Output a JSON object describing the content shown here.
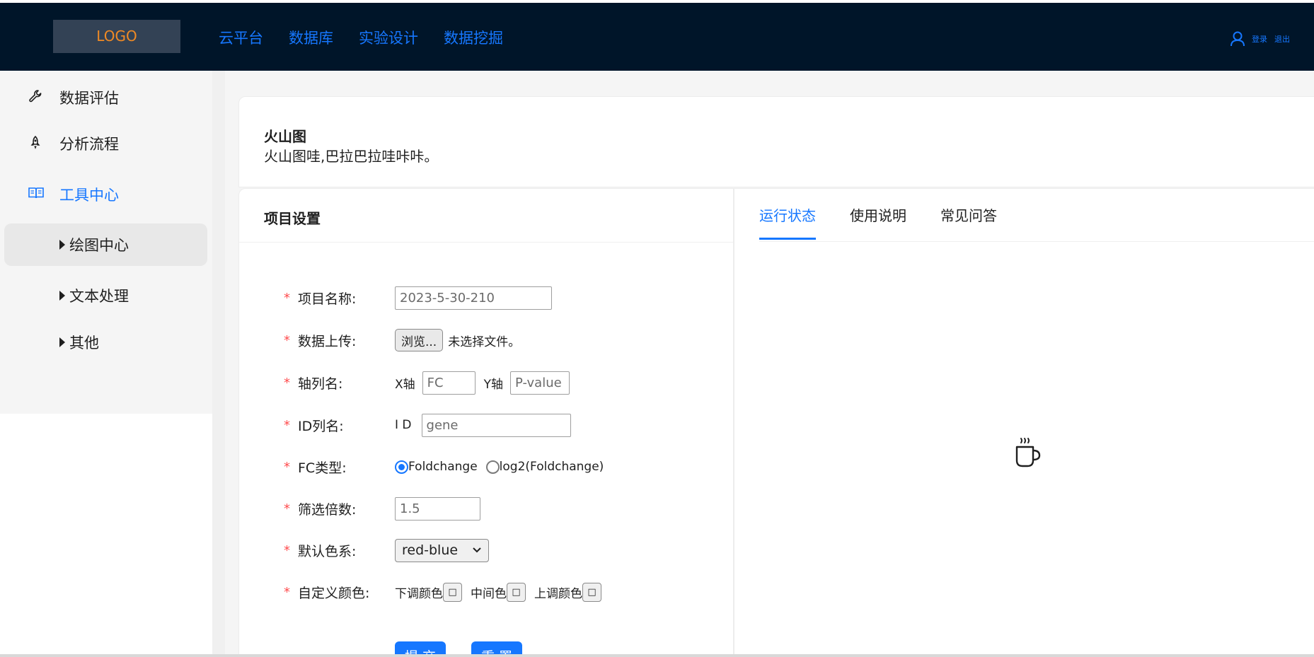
{
  "header": {
    "logo_text": "LOGO",
    "nav": [
      "云平台",
      "数据库",
      "实验设计",
      "数据挖掘"
    ],
    "user_icon": "user-icon",
    "login_label": "登录",
    "logout_label": "退出"
  },
  "sidebar": {
    "items": [
      {
        "label": "数据评估",
        "icon": "wrench-icon"
      },
      {
        "label": "分析流程",
        "icon": "rocket-icon"
      },
      {
        "label": "工具中心",
        "icon": "book-icon"
      }
    ],
    "sub_items": [
      "绘图中心",
      "文本处理",
      "其他"
    ]
  },
  "intro": {
    "title": "火山图",
    "description": "火山图哇,巴拉巴拉哇咔咔。"
  },
  "settings": {
    "title": "项目设置",
    "required_mark": "*",
    "fields": {
      "project_name": {
        "label": "项目名称:",
        "value": "2023-5-30-210"
      },
      "upload": {
        "label": "数据上传:",
        "button": "浏览...",
        "status": "未选择文件。"
      },
      "axis": {
        "label": "轴列名:",
        "x_label": "X轴",
        "x_value": "FC",
        "y_label": "Y轴",
        "y_value": "P-value"
      },
      "id": {
        "label": "ID列名:",
        "prefix": "I D",
        "value": "gene"
      },
      "fc_type": {
        "label": "FC类型:",
        "options": [
          "Foldchange",
          "log2(Foldchange)"
        ],
        "selected": "Foldchange"
      },
      "fold": {
        "label": "筛选倍数:",
        "value": "1.5"
      },
      "palette": {
        "label": "默认色系:",
        "value": "red-blue"
      },
      "custom_color": {
        "label": "自定义颜色:",
        "down": "下调颜色",
        "mid": "中间色",
        "up": "上调颜色"
      }
    },
    "submit_label": "提 交",
    "reset_label": "重 置"
  },
  "status_panel": {
    "tabs": [
      "运行状态",
      "使用说明",
      "常见问答"
    ],
    "active_tab": "运行状态",
    "empty_icon": "coffee-cup-icon"
  },
  "colors": {
    "header_bg": "#001529",
    "accent": "#1677ff",
    "logo_text": "#f08a24",
    "required": "#ff4d4f"
  }
}
